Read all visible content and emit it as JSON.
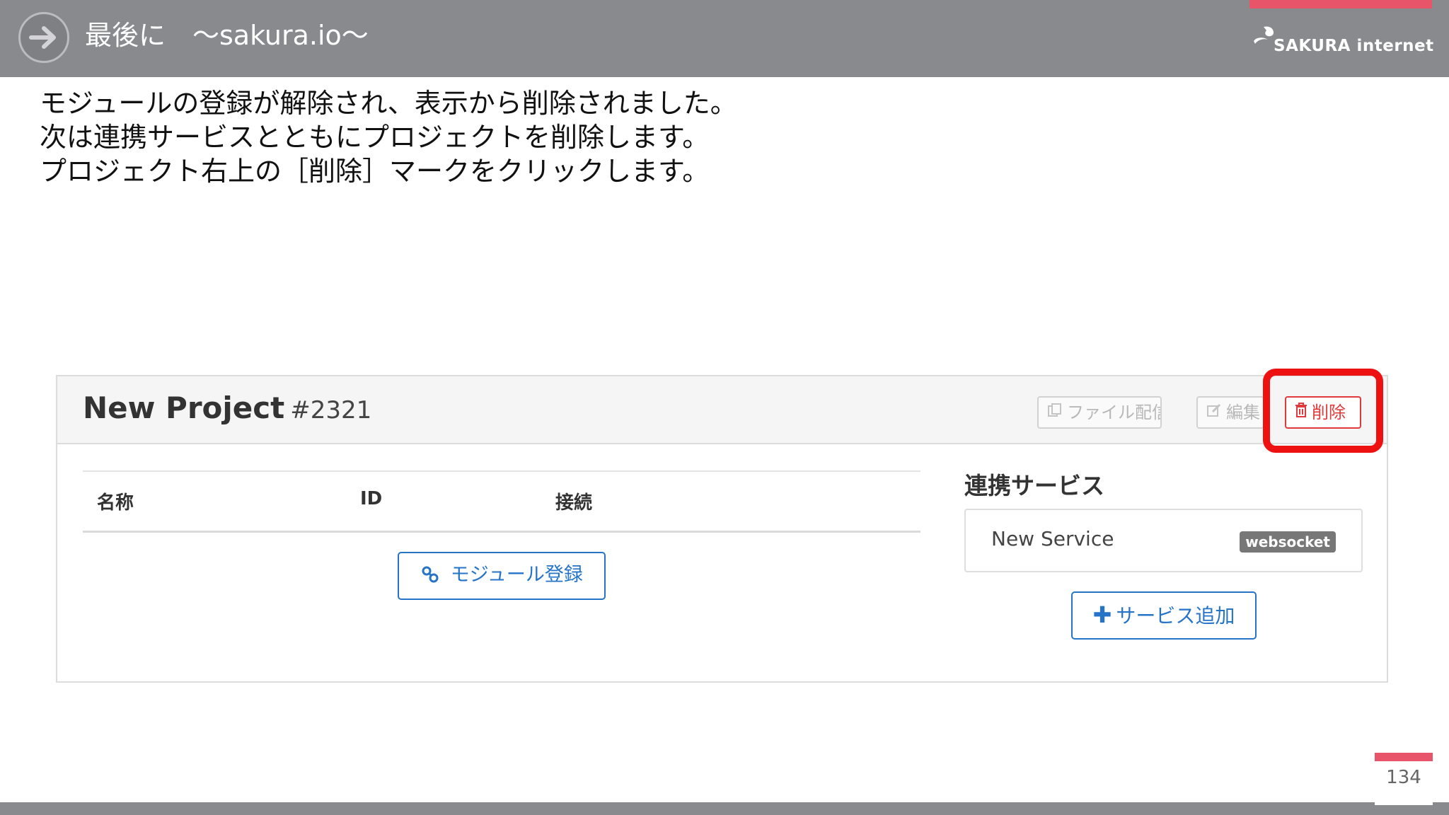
{
  "header": {
    "title": "最後に　～sakura.io～",
    "logo_text": "SAKURA internet",
    "colors": {
      "bar": "#898a8e",
      "accent": "#e8556b"
    }
  },
  "instructions": {
    "lines": [
      "モジュールの登録が解除され、表示から削除されました。",
      "次は連携サービスとともにプロジェクトを削除します。",
      "プロジェクト右上の［削除］マークをクリックします。"
    ]
  },
  "project": {
    "name": "New Project",
    "id": "#2321",
    "buttons": {
      "file": "ファイル配信",
      "edit": "編集",
      "delete": "削除"
    },
    "table": {
      "columns": [
        "名称",
        "ID",
        "接続"
      ]
    },
    "module_button": "モジュール登録",
    "services": {
      "heading": "連携サービス",
      "items": [
        {
          "name": "New Service",
          "badge": "websocket"
        }
      ],
      "add_button": "サービス追加"
    }
  },
  "footer": {
    "page_number": "134"
  },
  "icons": {
    "header_arrow": "arrow-right-icon",
    "file": "copy-icon",
    "edit": "edit-icon",
    "delete": "trash-icon",
    "module": "link-icon",
    "add": "plus-icon"
  }
}
